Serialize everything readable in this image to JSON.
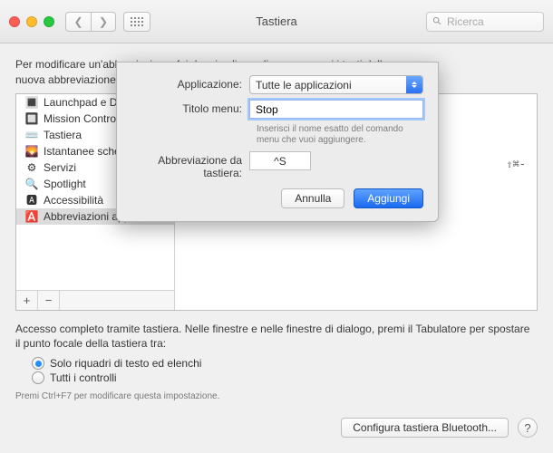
{
  "window": {
    "title": "Tastiera",
    "search_placeholder": "Ricerca"
  },
  "intro_line1": "Per modificare un'abbreviazione, fai doppio clic su di essa e premi i tasti della",
  "intro_line2": "nuova abbreviazione.",
  "sidebar": {
    "items": [
      {
        "label": "Launchpad e Dock"
      },
      {
        "label": "Mission Control"
      },
      {
        "label": "Tastiera"
      },
      {
        "label": "Istantanee schermo"
      },
      {
        "label": "Servizi"
      },
      {
        "label": "Spotlight"
      },
      {
        "label": "Accessibilità"
      },
      {
        "label": "Abbreviazioni app"
      }
    ],
    "selected_index": 7
  },
  "right_shortcut_display": "⇧⌘-",
  "kb_access_text": "Accesso completo tramite tastiera. Nelle finestre e nelle finestre di dialogo, premi il Tabulatore per spostare il punto focale della tastiera tra:",
  "radios": {
    "opt1": "Solo riquadri di testo ed elenchi",
    "opt2": "Tutti i controlli",
    "selected": 0
  },
  "hint": "Premi Ctrl+F7 per modificare questa impostazione.",
  "bt_button": "Configura tastiera Bluetooth...",
  "sheet": {
    "app_label": "Applicazione:",
    "app_value": "Tutte le applicazioni",
    "menu_label": "Titolo menu:",
    "menu_value": "Stop",
    "menu_hint": "Inserisci il nome esatto del comando menu che vuoi aggiungere.",
    "shortcut_label": "Abbreviazione da tastiera:",
    "shortcut_value": "^S",
    "cancel": "Annulla",
    "confirm": "Aggiungi"
  }
}
